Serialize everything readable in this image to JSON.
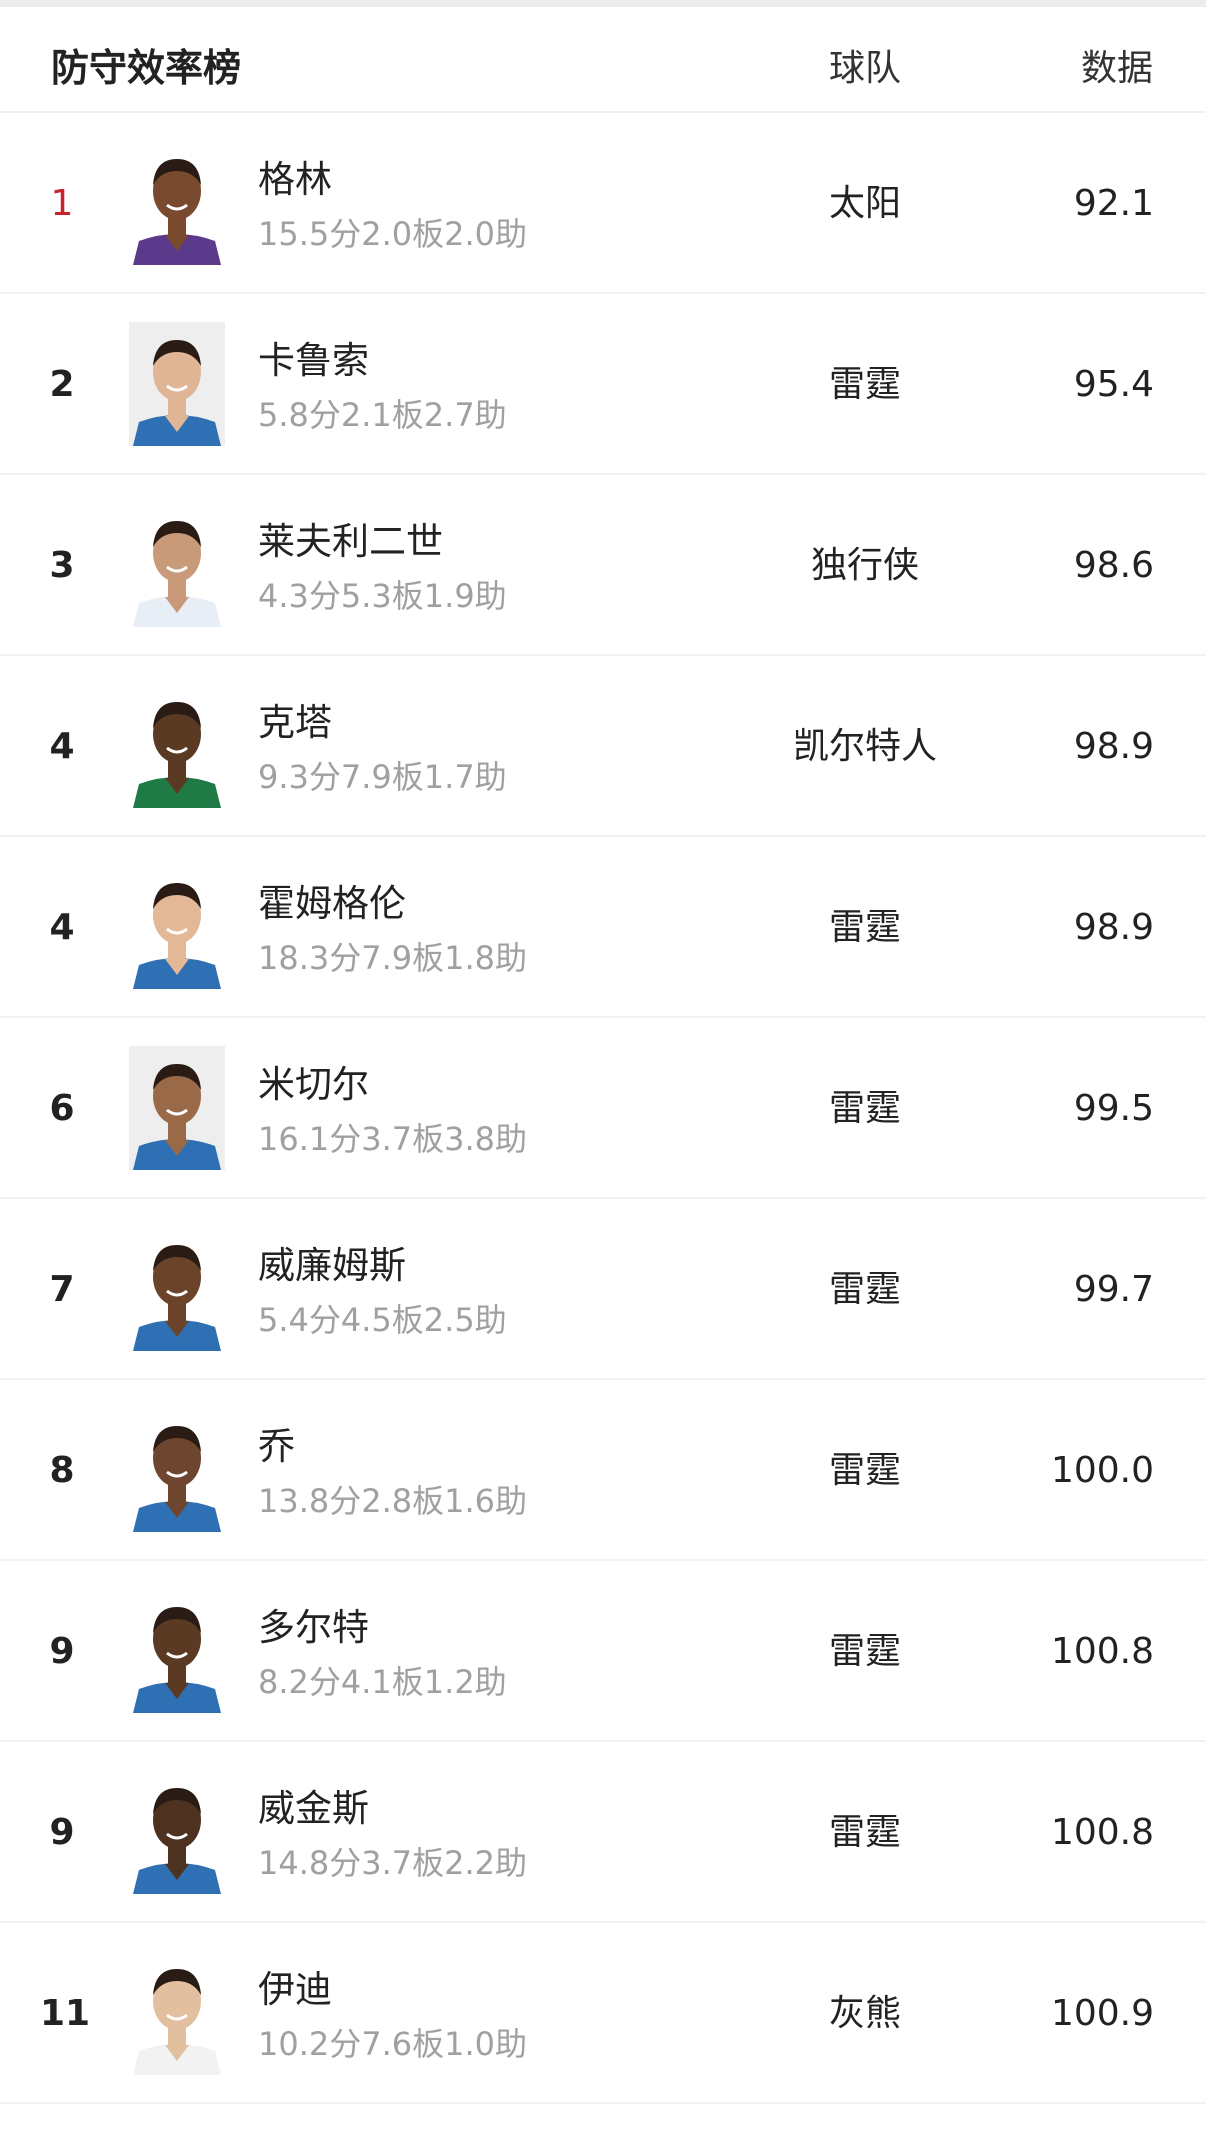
{
  "header": {
    "title": "防守效率榜",
    "team_col": "球队",
    "data_col": "数据"
  },
  "rows": [
    {
      "rank": "1",
      "name": "格林",
      "stats": "15.5分2.0板2.0助",
      "team": "太阳",
      "value": "92.1",
      "jersey": "#5b3a8c",
      "skin": "#7a4a2e",
      "bg": "#ffffff"
    },
    {
      "rank": "2",
      "name": "卡鲁索",
      "stats": "5.8分2.1板2.7助",
      "team": "雷霆",
      "value": "95.4",
      "jersey": "#2f6fb3",
      "skin": "#e0b595",
      "bg": "#eeeeee"
    },
    {
      "rank": "3",
      "name": "莱夫利二世",
      "stats": "4.3分5.3板1.9助",
      "team": "独行侠",
      "value": "98.6",
      "jersey": "#e8eef5",
      "skin": "#c99a7a",
      "bg": "#ffffff"
    },
    {
      "rank": "4",
      "name": "克塔",
      "stats": "9.3分7.9板1.7助",
      "team": "凯尔特人",
      "value": "98.9",
      "jersey": "#1f7a45",
      "skin": "#5a3a22",
      "bg": "#ffffff"
    },
    {
      "rank": "4",
      "name": "霍姆格伦",
      "stats": "18.3分7.9板1.8助",
      "team": "雷霆",
      "value": "98.9",
      "jersey": "#2f6fb3",
      "skin": "#e3b896",
      "bg": "#ffffff"
    },
    {
      "rank": "6",
      "name": "米切尔",
      "stats": "16.1分3.7板3.8助",
      "team": "雷霆",
      "value": "99.5",
      "jersey": "#2f6fb3",
      "skin": "#9a6a48",
      "bg": "#eeeeee"
    },
    {
      "rank": "7",
      "name": "威廉姆斯",
      "stats": "5.4分4.5板2.5助",
      "team": "雷霆",
      "value": "99.7",
      "jersey": "#2f6fb3",
      "skin": "#6b4329",
      "bg": "#ffffff"
    },
    {
      "rank": "8",
      "name": "乔",
      "stats": "13.8分2.8板1.6助",
      "team": "雷霆",
      "value": "100.0",
      "jersey": "#2f6fb3",
      "skin": "#6e4630",
      "bg": "#ffffff"
    },
    {
      "rank": "9",
      "name": "多尔特",
      "stats": "8.2分4.1板1.2助",
      "team": "雷霆",
      "value": "100.8",
      "jersey": "#2f6fb3",
      "skin": "#5a3a22",
      "bg": "#ffffff"
    },
    {
      "rank": "9",
      "name": "威金斯",
      "stats": "14.8分3.7板2.2助",
      "team": "雷霆",
      "value": "100.8",
      "jersey": "#2f6fb3",
      "skin": "#4e3220",
      "bg": "#ffffff"
    },
    {
      "rank": "11",
      "name": "伊迪",
      "stats": "10.2分7.6板1.0助",
      "team": "灰熊",
      "value": "100.9",
      "jersey": "#f2f2f2",
      "skin": "#e2bf9f",
      "bg": "#ffffff"
    }
  ]
}
